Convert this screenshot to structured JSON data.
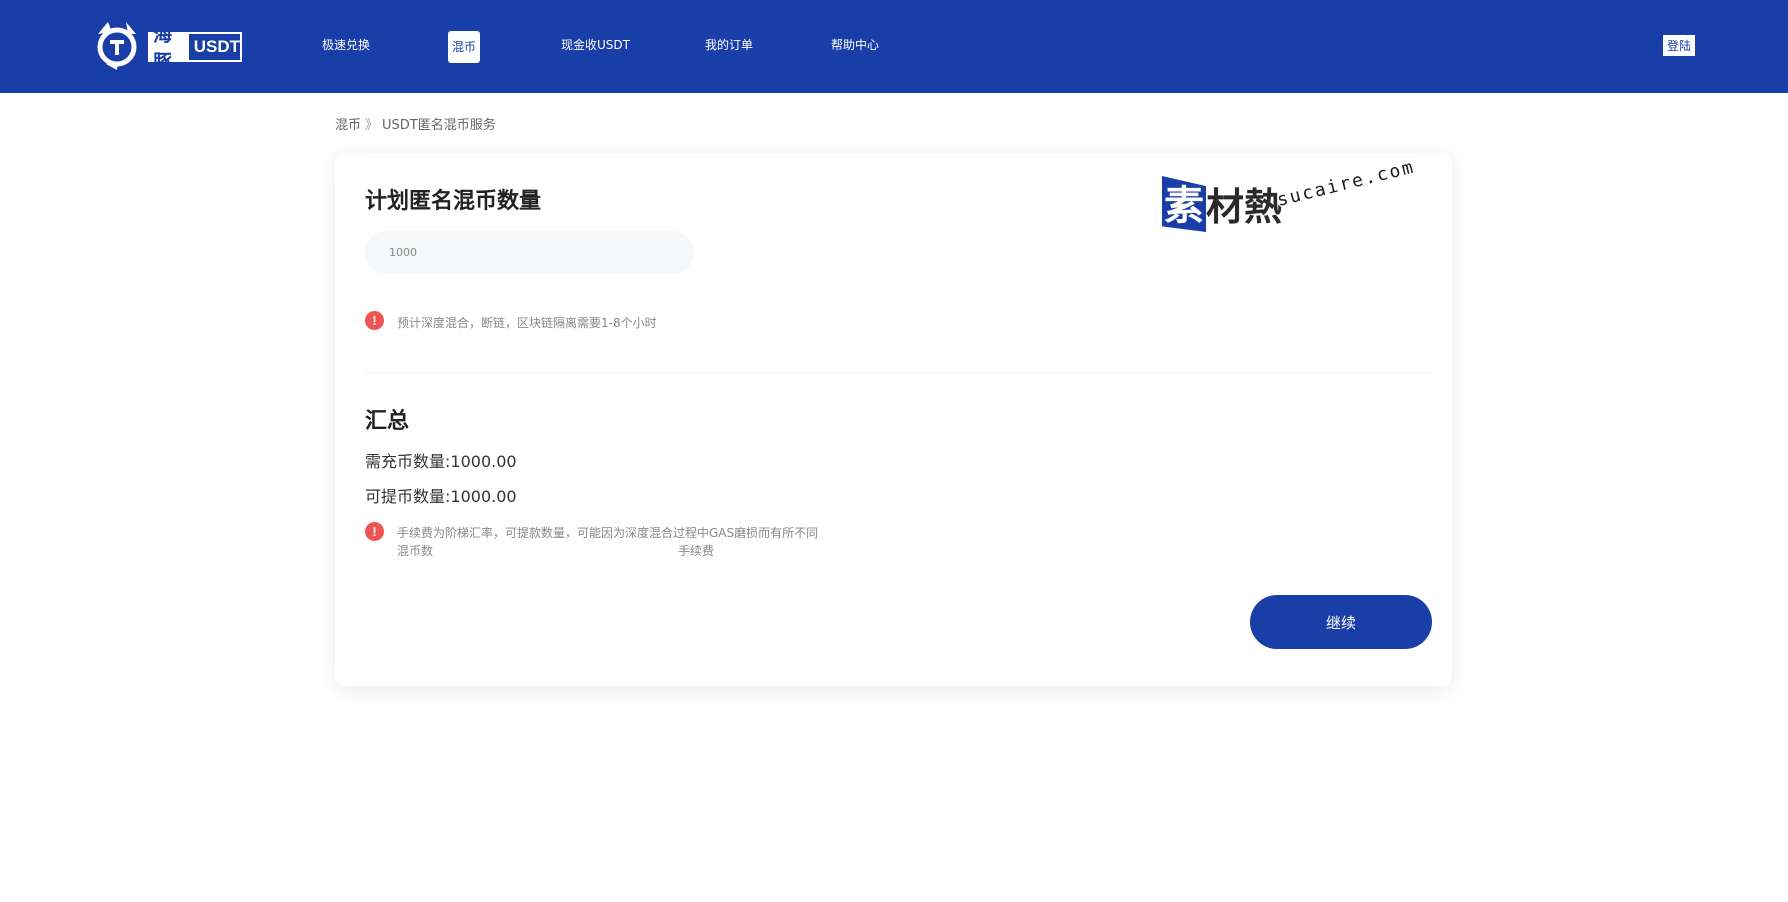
{
  "brand": {
    "name_cn": "海豚",
    "name_en": "USDT"
  },
  "nav": {
    "items": [
      {
        "label": "极速兑换"
      },
      {
        "label": "混币"
      },
      {
        "label": "现金收USDT"
      },
      {
        "label": "我的订单"
      },
      {
        "label": "帮助中心"
      }
    ],
    "active_label": "混币",
    "login_label": "登陆"
  },
  "breadcrumb": {
    "parent": "混币",
    "separator": "》",
    "current": "USDT匿名混币服务"
  },
  "plan": {
    "title": "计划匿名混币数量",
    "input_value": "1000",
    "note": "预计深度混合，断链，区块链隔离需要1-8个小时"
  },
  "summary": {
    "title": "汇总",
    "deposit_label": "需充币数量:",
    "deposit_value": "1000.00",
    "withdraw_label": "可提币数量:",
    "withdraw_value": "1000.00",
    "fee_note_line1": "手续费为阶梯汇率，可提款数量，可能因为深度混合过程中GAS磨损而有所不同",
    "fee_note_line2a": "混币数",
    "fee_note_line2b": "手续费"
  },
  "actions": {
    "continue_label": "继续"
  },
  "watermark": {
    "char1": "素",
    "chars": "材熱",
    "url": "sucaire.com"
  },
  "colors": {
    "primary": "#1a3ea8",
    "warning": "#ef5353"
  },
  "icons": [
    "dolphin-logo-icon",
    "warning-icon"
  ]
}
